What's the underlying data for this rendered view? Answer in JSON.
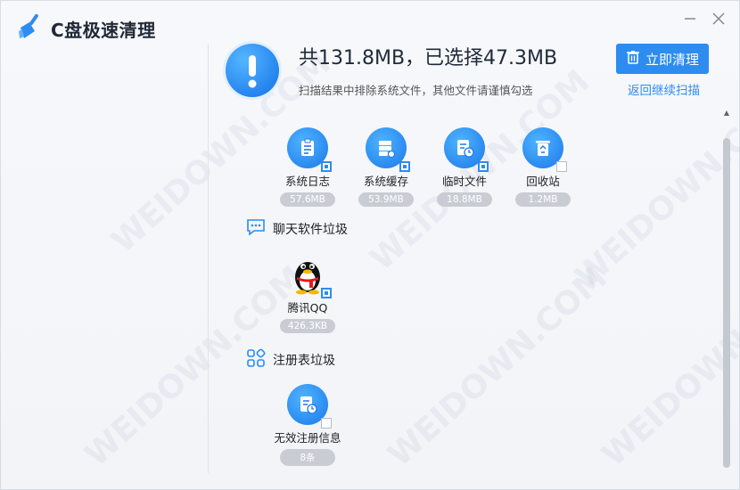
{
  "app": {
    "title": "C盘极速清理"
  },
  "header": {
    "summary": "共131.8MB，已选择47.3MB",
    "subtext": "扫描结果中排除系统文件，其他文件请谨慎勾选",
    "clean_button": "立即清理",
    "back_link": "返回继续扫描"
  },
  "system_items": [
    {
      "label": "系统日志",
      "size": "57.6MB",
      "checked": true,
      "icon": "document-list-icon"
    },
    {
      "label": "系统缓存",
      "size": "53.9MB",
      "checked": true,
      "icon": "server-cloud-icon"
    },
    {
      "label": "临时文件",
      "size": "18.8MB",
      "checked": true,
      "icon": "temp-file-clock-icon"
    },
    {
      "label": "回收站",
      "size": "1.2MB",
      "checked": false,
      "icon": "recycle-bin-icon"
    }
  ],
  "sections": {
    "chat": {
      "label": "聊天软件垃圾",
      "icon": "chat-bubble-icon"
    },
    "registry": {
      "label": "注册表垃圾",
      "icon": "grid-icon"
    }
  },
  "chat_items": [
    {
      "label": "腾讯QQ",
      "size": "426.3KB",
      "checked": true,
      "icon": "qq-penguin-icon"
    }
  ],
  "registry_items": [
    {
      "label": "无效注册信息",
      "size": "8条",
      "checked": false,
      "icon": "registry-file-icon"
    }
  ],
  "watermark_text": "WEIDOWN.COM",
  "colors": {
    "accent": "#2d8cf0",
    "badge": "#c9cdd3"
  }
}
